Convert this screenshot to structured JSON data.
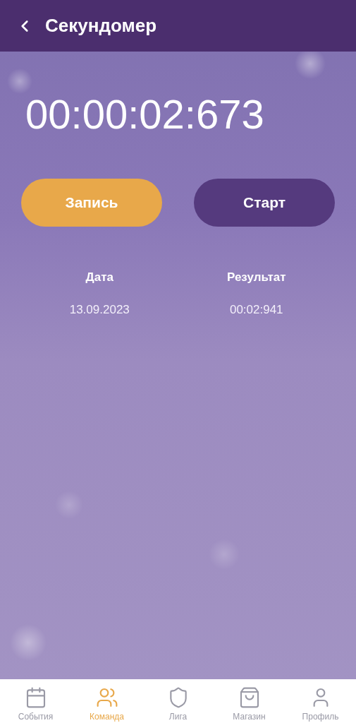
{
  "header": {
    "title": "Секундомер"
  },
  "timer": {
    "value": "00:00:02:673"
  },
  "buttons": [
    {
      "label": "Запись",
      "kind": "record"
    },
    {
      "label": "Старт",
      "kind": "start"
    }
  ],
  "results": {
    "columns": [
      "Дата",
      "Результат"
    ],
    "rows": [
      [
        "13.09.2023",
        "00:02:941"
      ]
    ]
  },
  "nav": [
    {
      "label": "События",
      "kind": "events",
      "selected": false
    },
    {
      "label": "Команда",
      "kind": "team",
      "selected": true
    },
    {
      "label": "Лига",
      "kind": "league",
      "selected": false
    },
    {
      "label": "Магазин",
      "kind": "shop",
      "selected": false
    },
    {
      "label": "Профиль",
      "kind": "profile",
      "selected": false
    }
  ]
}
